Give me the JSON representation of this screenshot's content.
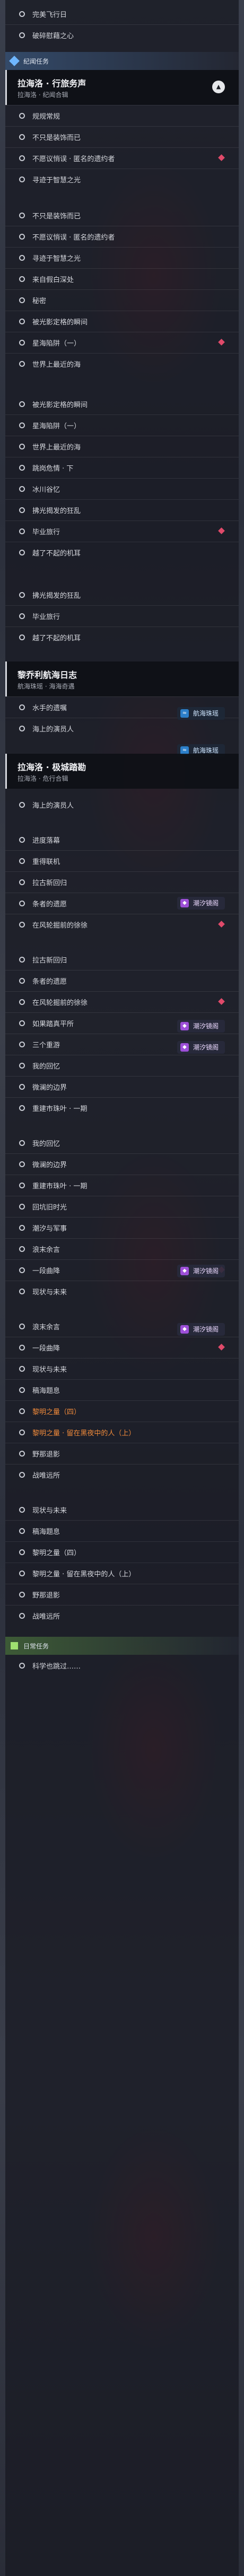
{
  "colors": {
    "current_task": "#f08a3a",
    "diamond_marker": "#e04a6a",
    "anomaly_badge": "#9d4fd8",
    "sea_badge": "#2c7fc9"
  },
  "tasks_a": [
    "完美飞行日",
    "破碎慰藉之心"
  ],
  "section_1": {
    "label": "纪闻任务"
  },
  "quest_1": {
    "title": "拉海洛 · 行旅务声",
    "subtitle": "拉海洛 · 纪闻合辑",
    "toggle_icon": "▲"
  },
  "tasks_b": [
    "规规常规",
    "不只是装饰而已",
    "不愿议悄误 · 匿名的遗约者",
    "寻迹于智慧之光"
  ],
  "tasks_c": [
    "不只是装饰而已",
    "不愿议悄误 · 匿名的遗约者",
    "寻迹于智慧之光",
    "来自假白深处",
    "秘密",
    "被光影定格的瞬间",
    "星海陷阱（一）",
    "世界上最近的海"
  ],
  "tasks_d": [
    "被光影定格的瞬间",
    "星海陷阱（一）",
    "世界上最近的海",
    "跳岗危情 · 下",
    "冰川谷忆",
    "拂光揭发的狂乱",
    "毕业旅行",
    "越了不起的机耳"
  ],
  "tasks_e": [
    "拂光揭发的狂乱",
    "毕业旅行",
    "越了不起的机耳"
  ],
  "quest_2": {
    "title": "黎乔利航海日志",
    "subtitle": "航海珠瑶 · 海海奇遇"
  },
  "tasks_f": [
    "水手的遗嘱",
    "海上的演员人"
  ],
  "reward_sea": "航海珠瑶",
  "quest_3": {
    "title": "拉海洛 · 极城踏勘",
    "subtitle": "拉海洛 · 危行合辑"
  },
  "tasks_g": [
    "海上的演员人"
  ],
  "tasks_h": [
    "进度落幕",
    "重得联机",
    "拉古新回归",
    "条者的遗愿",
    "在风轮掘前的徐徐"
  ],
  "reward_anomaly": "潮汐镜阁",
  "tasks_i": [
    "拉古新回归",
    "条者的遗愿",
    "在风轮掘前的徐徐",
    "如果踏真平所",
    "三个重游",
    "我的回忆",
    "微澜的边界",
    "重建市珠叶 · 一期"
  ],
  "tasks_j": [
    "我的回忆",
    "微澜的边界",
    "重建市珠叶 · 一期",
    "回坑旧时光",
    "潮汐与军事",
    "浪末余言",
    "一段曲降",
    "现状与未来"
  ],
  "tasks_k": [
    "浪末余言",
    "一段曲降",
    "现状与未来",
    "稿海题息",
    "黎明之量（四）",
    "黎明之量 · 留在黑夜中的人（上）",
    "野那退影",
    "战唯远所"
  ],
  "tasks_l": [
    "现状与未来",
    "稿海题息",
    "黎明之量（四）",
    "黎明之量 · 留在黑夜中的人（上）",
    "野那退影",
    "战唯远所"
  ],
  "section_2": {
    "label": "日常任务"
  },
  "tasks_m": [
    "科学也跳过……"
  ]
}
